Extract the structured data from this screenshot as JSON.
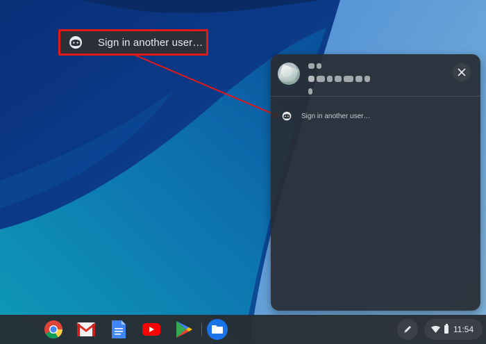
{
  "callout": {
    "label": "Sign in another user…",
    "highlight_color": "#e11a1a"
  },
  "user_menu": {
    "signin_label": "Sign in another user…",
    "close_icon": "close-icon",
    "avatar": "user-avatar"
  },
  "shelf": {
    "apps": [
      "Chrome",
      "Gmail",
      "Docs",
      "YouTube",
      "Play Store",
      "Files"
    ],
    "stylus_icon": "stylus-icon",
    "tray": {
      "wifi_icon": "wifi-icon",
      "battery_icon": "battery-icon",
      "time": "11:54"
    }
  },
  "colors": {
    "panel_bg": "#282d34",
    "shelf_bg": "#282c32",
    "accent": "#1a73e8"
  }
}
